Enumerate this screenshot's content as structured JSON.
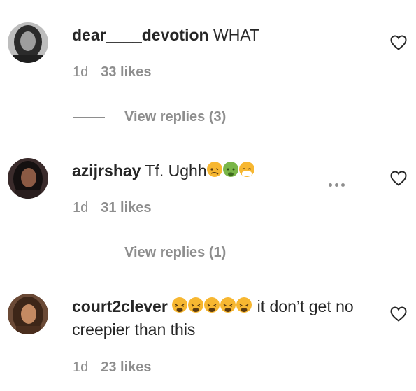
{
  "comments": [
    {
      "username": "dear____devotion",
      "text": " WHAT",
      "time": "1d",
      "likes": "33 likes",
      "replies": "View replies (3)",
      "avatar_icon": "avatar-dark-hair",
      "like_icon": "heart-outline-icon"
    },
    {
      "username": "azijrshay",
      "text": " Tf. Ughh",
      "emojis": [
        "woozy-face",
        "nauseated-face",
        "face-with-medical-mask"
      ],
      "time": "1d",
      "likes": "31 likes",
      "replies": "View replies (1)",
      "avatar_icon": "avatar-dark-hair",
      "like_icon": "heart-outline-icon",
      "more_icon": "more-horizontal-icon"
    },
    {
      "username": "court2clever",
      "emojis": [
        "weary-face",
        "weary-face",
        "weary-face",
        "weary-face",
        "weary-face"
      ],
      "text": " it don’t get no creepier than this",
      "time": "1d",
      "likes": "23 likes",
      "avatar_icon": "avatar-brown-hair",
      "like_icon": "heart-outline-icon"
    }
  ],
  "colors": {
    "text": "#262626",
    "secondary": "#8e8e8e",
    "background": "#ffffff",
    "emoji": "#f7b731"
  }
}
